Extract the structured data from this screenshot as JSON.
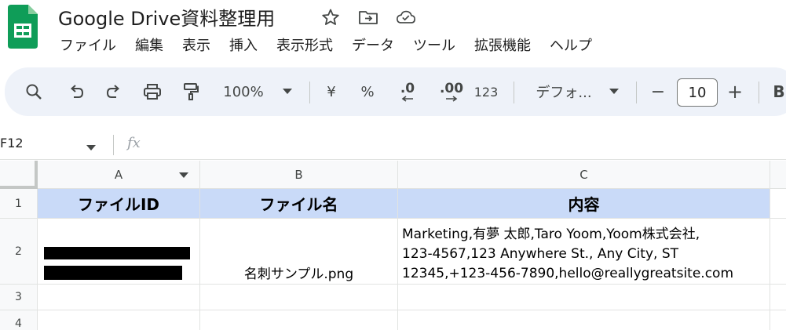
{
  "app": {
    "title": "Google Drive資料整理用"
  },
  "menu": [
    "ファイル",
    "編集",
    "表示",
    "挿入",
    "表示形式",
    "データ",
    "ツール",
    "拡張機能",
    "ヘルプ"
  ],
  "toolbar": {
    "zoom": "100%",
    "currency": "¥",
    "percent": "%",
    "decrease_decimal": ".0",
    "increase_decimal": ".00",
    "number_format": "123",
    "font": "デフォ...",
    "font_size": "10",
    "minus": "−",
    "plus": "+",
    "bold": "B"
  },
  "formula_bar": {
    "cell_ref": "F12",
    "fx": "fx",
    "value": ""
  },
  "sheet": {
    "columns": [
      "A",
      "B",
      "C"
    ],
    "rows": [
      "1",
      "2",
      "3",
      "4"
    ],
    "header_row": [
      "ファイルID",
      "ファイル名",
      "内容"
    ],
    "data_row": {
      "file_name": "名刺サンプル.png",
      "content_lines": [
        "Marketing,有夢 太郎,Taro Yoom,Yoom株式会社,",
        "123-4567,123 Anywhere St., Any City, ST",
        "12345,+123-456-7890,hello@reallygreatsite.com"
      ]
    }
  },
  "colors": {
    "header_fill": "#c9daf8",
    "toolbar_bg": "#eef2f9",
    "sheets_green": "#0f9d58"
  }
}
